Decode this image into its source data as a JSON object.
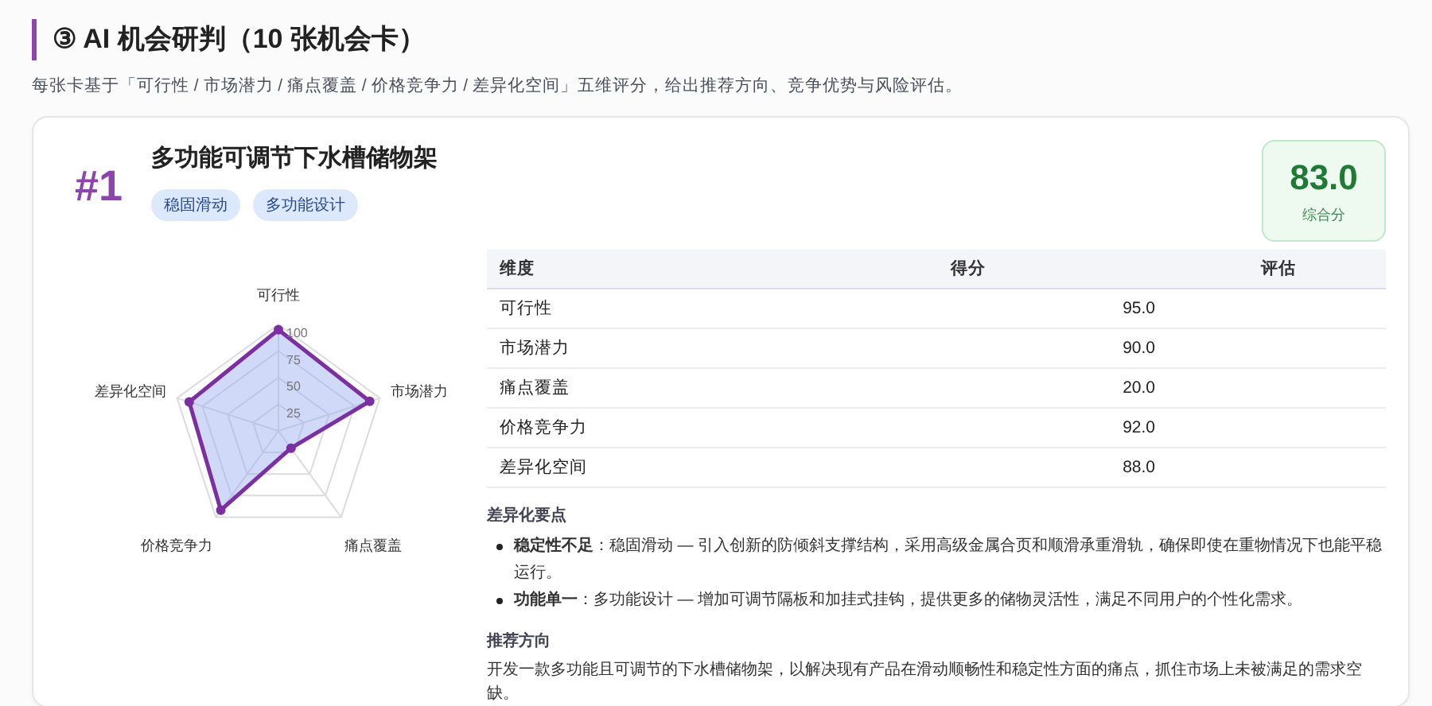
{
  "section": {
    "title": "③ AI 机会研判（10 张机会卡）",
    "subtitle": "每张卡基于「可行性 / 市场潜力 / 痛点覆盖 / 价格竞争力 / 差异化空间」五维评分，给出推荐方向、竞争优势与风险评估。"
  },
  "card": {
    "rank": "#1",
    "title": "多功能可调节下水槽储物架",
    "tags": [
      "稳固滑动",
      "多功能设计"
    ],
    "score": "83.0",
    "score_label": "综合分",
    "radar": {
      "axis_labels": [
        "可行性",
        "市场潜力",
        "痛点覆盖",
        "价格竞争力",
        "差异化空间"
      ],
      "ticks": [
        "100",
        "75",
        "50",
        "25"
      ]
    },
    "table": {
      "columns": [
        "维度",
        "得分",
        "评估"
      ],
      "rows": [
        {
          "dimension": "可行性",
          "score": "95.0"
        },
        {
          "dimension": "市场潜力",
          "score": "90.0"
        },
        {
          "dimension": "痛点覆盖",
          "score": "20.0"
        },
        {
          "dimension": "价格竞争力",
          "score": "92.0"
        },
        {
          "dimension": "差异化空间",
          "score": "88.0"
        }
      ]
    },
    "differentiation": {
      "heading": "差异化要点",
      "items": [
        "**稳定性不足**：稳固滑动 — 引入创新的防倾斜支撑结构，采用高级金属合页和顺滑承重滑轨，确保即使在重物情况下也能平稳运行。",
        "**功能单一**：多功能设计 — 增加可调节隔板和加挂式挂钩，提供更多的储物灵活性，满足不同用户的个性化需求。"
      ]
    },
    "recommendation": {
      "heading": "推荐方向",
      "text": "开发一款多功能且可调节的下水槽储物架，以解决现有产品在滑动顺畅性和稳定性方面的痛点，抓住市场上未被满足的需求空缺。"
    }
  }
}
